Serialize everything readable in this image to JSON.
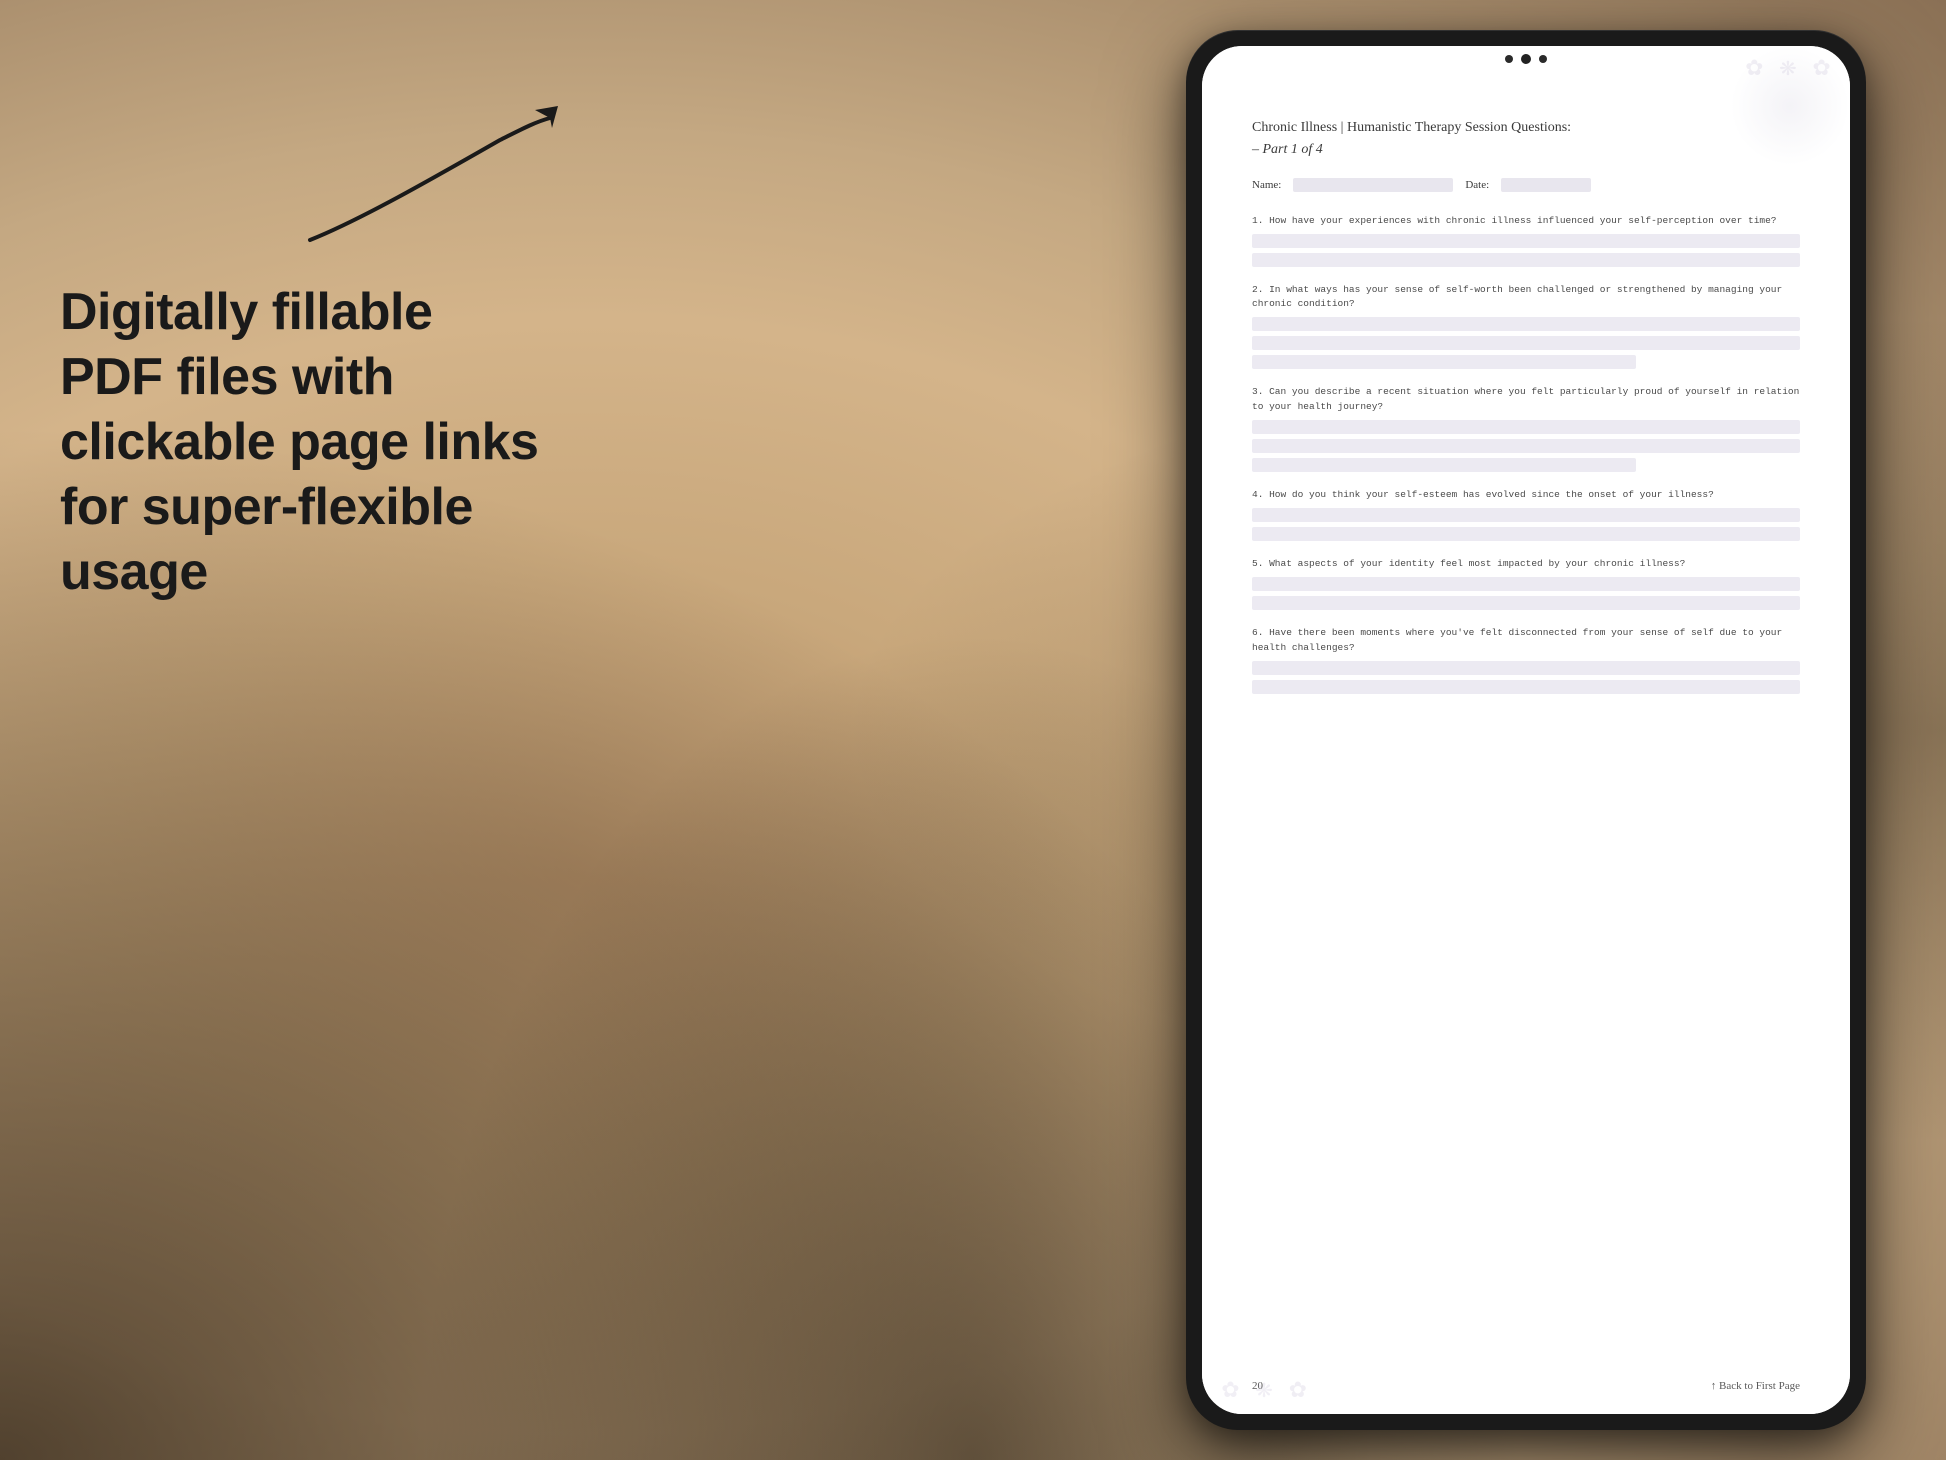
{
  "background": {
    "color_left": "#c4a882",
    "color_right": "#b8936a"
  },
  "left_panel": {
    "arrow_visible": true,
    "main_text": "Digitally fillable PDF files with clickable page links for super-flexible usage"
  },
  "tablet": {
    "camera_dots": 3
  },
  "pdf": {
    "title": "Chronic Illness | Humanistic Therapy Session Questions:",
    "subtitle": "– Part 1 of 4",
    "name_label": "Name:",
    "date_label": "Date:",
    "questions": [
      {
        "number": "1.",
        "text": "How have your experiences with chronic illness influenced your self-perception over time?",
        "answer_lines": 2
      },
      {
        "number": "2.",
        "text": "In what ways has your sense of self-worth been challenged or strengthened by managing your chronic condition?",
        "answer_lines": 3
      },
      {
        "number": "3.",
        "text": "Can you describe a recent situation where you felt particularly proud of yourself in relation to your health journey?",
        "answer_lines": 3
      },
      {
        "number": "4.",
        "text": "How do you think your self-esteem has evolved since the onset of your illness?",
        "answer_lines": 2
      },
      {
        "number": "5.",
        "text": "What aspects of your identity feel most impacted by your chronic illness?",
        "answer_lines": 2
      },
      {
        "number": "6.",
        "text": "Have there been moments where you've felt disconnected from your sense of self due to your health challenges?",
        "answer_lines": 2
      }
    ],
    "footer": {
      "page_number": "20",
      "back_link": "↑ Back to First Page"
    }
  }
}
